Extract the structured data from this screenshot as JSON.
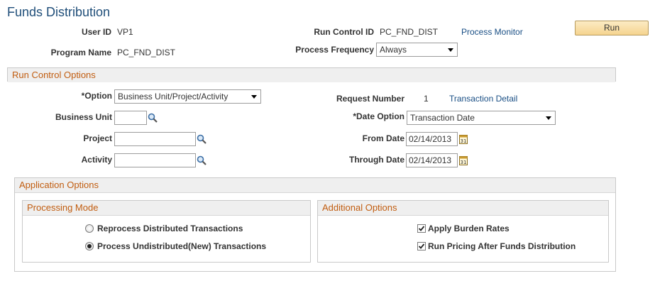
{
  "page": {
    "title": "Funds Distribution"
  },
  "header": {
    "user_id_label": "User ID",
    "user_id_value": "VP1",
    "program_name_label": "Program Name",
    "program_name_value": "PC_FND_DIST",
    "run_control_id_label": "Run Control ID",
    "run_control_id_value": "PC_FND_DIST",
    "process_monitor_link": "Process Monitor",
    "process_frequency_label": "Process Frequency",
    "process_frequency_value": "Always",
    "run_button": "Run"
  },
  "run_control_options": {
    "title": "Run Control Options",
    "option_label": "*Option",
    "option_value": "Business Unit/Project/Activity",
    "business_unit_label": "Business Unit",
    "business_unit_value": "",
    "project_label": "Project",
    "project_value": "",
    "activity_label": "Activity",
    "activity_value": "",
    "request_number_label": "Request Number",
    "request_number_value": "1",
    "transaction_detail_link": "Transaction Detail",
    "date_option_label": "*Date Option",
    "date_option_value": "Transaction Date",
    "from_date_label": "From Date",
    "from_date_value": "02/14/2013",
    "through_date_label": "Through Date",
    "through_date_value": "02/14/2013"
  },
  "application_options": {
    "title": "Application Options",
    "processing_mode": {
      "title": "Processing Mode",
      "options": [
        {
          "label": "Reprocess Distributed Transactions",
          "selected": false
        },
        {
          "label": "Process Undistributed(New) Transactions",
          "selected": true
        }
      ]
    },
    "additional_options": {
      "title": "Additional Options",
      "options": [
        {
          "label": "Apply Burden Rates",
          "checked": true
        },
        {
          "label": "Run Pricing After Funds Distribution",
          "checked": true
        }
      ]
    }
  },
  "colors": {
    "title": "#1f4e79",
    "link": "#1a4f85",
    "group_header_text": "#c15d10",
    "run_button_bg": "#f5d48f"
  },
  "icons": {
    "lookup": "magnifier-icon",
    "calendar": "calendar-icon",
    "dropdown": "chevron-down-icon"
  }
}
